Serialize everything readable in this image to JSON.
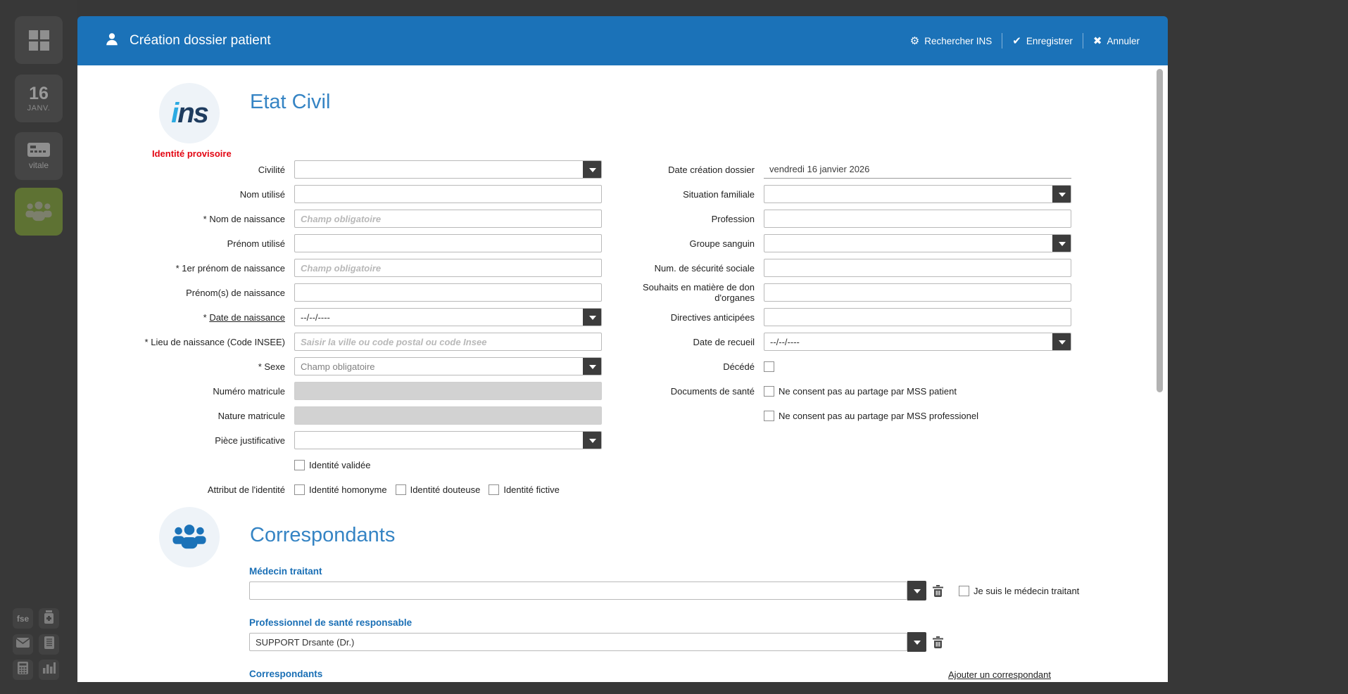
{
  "colors": {
    "accent": "#1b72b8",
    "section_title_blue": "#3584c4",
    "label_blue": "#1a6fb5",
    "badge_red": "#e30613",
    "sidebar_active_green": "#5e7233"
  },
  "sidebar": {
    "top_items": [
      {
        "name": "apps",
        "icon": "apps-grid-icon"
      },
      {
        "name": "calendar",
        "icon": "calendar-icon",
        "day": "16",
        "month": "JANV."
      },
      {
        "name": "carte-vitale",
        "icon": "vitale-card-icon",
        "label": "vitale"
      },
      {
        "name": "patients",
        "icon": "patients-group-icon",
        "active": true
      }
    ],
    "bottom_items": [
      {
        "name": "fse",
        "icon": "fse-text-icon",
        "label": "fse"
      },
      {
        "name": "pharmacy",
        "icon": "medicine-bottle-icon"
      },
      {
        "name": "mail",
        "icon": "envelope-icon"
      },
      {
        "name": "documents",
        "icon": "document-icon"
      },
      {
        "name": "calculator",
        "icon": "calculator-icon"
      },
      {
        "name": "statistics",
        "icon": "bar-chart-icon"
      }
    ]
  },
  "header": {
    "icon": "user-icon",
    "title": "Création dossier patient",
    "actions": [
      {
        "icon": "gear-icon",
        "label": "Rechercher INS"
      },
      {
        "icon": "check-icon",
        "label": "Enregistrer"
      },
      {
        "icon": "x-icon",
        "label": "Annuler"
      }
    ]
  },
  "etat_civil": {
    "logo": {
      "i": "i",
      "ns": "ns"
    },
    "title": "Etat Civil",
    "badge": "Identité provisoire",
    "left": [
      {
        "label": "Civilité",
        "value": ""
      },
      {
        "label": "Nom utilisé",
        "value": ""
      },
      {
        "label": "* Nom de naissance",
        "placeholder": "Champ obligatoire"
      },
      {
        "label": "Prénom utilisé",
        "value": ""
      },
      {
        "label": "* 1er prénom de naissance",
        "placeholder": "Champ obligatoire"
      },
      {
        "label": "Prénom(s) de naissance",
        "value": ""
      },
      {
        "label": "* ",
        "label_underlined": "Date de naissance",
        "value": "--/--/----"
      },
      {
        "label": "* Lieu de naissance (Code INSEE)",
        "placeholder": "Saisir la ville ou code postal ou code Insee"
      },
      {
        "label": "* Sexe",
        "value": "Champ obligatoire"
      },
      {
        "label": "Numéro matricule",
        "value": ""
      },
      {
        "label": "Nature matricule",
        "value": ""
      },
      {
        "label": "Pièce justificative",
        "value": ""
      },
      {
        "label": "",
        "checkbox": "Identité validée"
      },
      {
        "label": "Attribut de l'identité",
        "checkboxes": [
          "Identité homonyme",
          "Identité douteuse",
          "Identité fictive"
        ]
      }
    ],
    "right": [
      {
        "label": "Date création dossier",
        "value": "vendredi 16 janvier 2026"
      },
      {
        "label": "Situation familiale",
        "value": ""
      },
      {
        "label": "Profession",
        "value": ""
      },
      {
        "label": "Groupe sanguin",
        "value": ""
      },
      {
        "label": "Num. de sécurité sociale",
        "value": ""
      },
      {
        "label": "Souhaits en matière de don d'organes",
        "value": ""
      },
      {
        "label": "Directives anticipées",
        "value": ""
      },
      {
        "label": "Date de recueil",
        "value": "--/--/----"
      },
      {
        "label": "Décédé"
      },
      {
        "label": "Documents de santé",
        "checkbox": "Ne consent pas au partage par MSS patient"
      },
      {
        "label": "",
        "checkbox": "Ne consent pas au partage par MSS professionel"
      }
    ]
  },
  "correspondants": {
    "title": "Correspondants",
    "medecin_traitant_label": "Médecin traitant",
    "medecin_traitant_value": "",
    "je_suis_checkbox_label": "Je suis le médecin traitant",
    "professionnel_label": "Professionnel de santé responsable",
    "professionnel_value": "SUPPORT Drsante (Dr.)",
    "correspondants_label": "Correspondants",
    "add_link": "Ajouter un correspondant"
  }
}
